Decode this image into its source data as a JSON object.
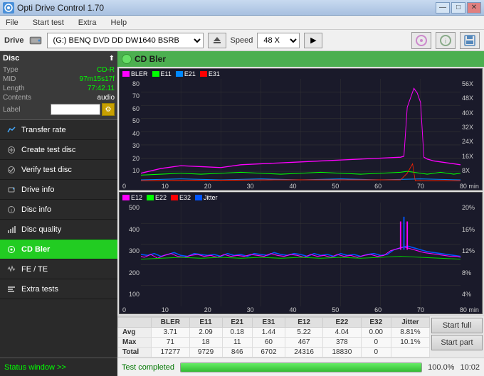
{
  "titlebar": {
    "title": "Opti Drive Control 1.70",
    "icon": "ODC",
    "minimize": "—",
    "maximize": "□",
    "close": "✕"
  },
  "menubar": {
    "items": [
      "File",
      "Start test",
      "Extra",
      "Help"
    ]
  },
  "drivebar": {
    "drive_label": "Drive",
    "drive_value": "(G:)  BENQ DVD DD DW1640 BSRB",
    "speed_label": "Speed",
    "speed_value": "48 X"
  },
  "disc": {
    "title": "Disc",
    "type_label": "Type",
    "type_value": "CD-R",
    "mid_label": "MID",
    "mid_value": "97m15s17f",
    "length_label": "Length",
    "length_value": "77:42.11",
    "contents_label": "Contents",
    "contents_value": "audio",
    "label_label": "Label"
  },
  "nav": {
    "items": [
      {
        "id": "transfer-rate",
        "label": "Transfer rate",
        "active": false
      },
      {
        "id": "create-test-disc",
        "label": "Create test disc",
        "active": false
      },
      {
        "id": "verify-test-disc",
        "label": "Verify test disc",
        "active": false
      },
      {
        "id": "drive-info",
        "label": "Drive info",
        "active": false
      },
      {
        "id": "disc-info",
        "label": "Disc info",
        "active": false
      },
      {
        "id": "disc-quality",
        "label": "Disc quality",
        "active": false
      },
      {
        "id": "cd-bler",
        "label": "CD Bler",
        "active": true
      },
      {
        "id": "fe-te",
        "label": "FE / TE",
        "active": false
      },
      {
        "id": "extra-tests",
        "label": "Extra tests",
        "active": false
      }
    ]
  },
  "status_window": "Status window >>",
  "chart_title": "CD Bler",
  "chart1": {
    "legend": [
      {
        "label": "BLER",
        "color": "#ff00ff"
      },
      {
        "label": "E11",
        "color": "#00ff00"
      },
      {
        "label": "E21",
        "color": "#0000ff"
      },
      {
        "label": "E31",
        "color": "#ff0000"
      }
    ],
    "y_left": [
      "80-",
      "70-",
      "60-",
      "50-",
      "40-",
      "30-",
      "20-",
      "10-"
    ],
    "y_right": [
      "56X",
      "48X",
      "40X",
      "32X",
      "24X",
      "16X",
      "8X"
    ],
    "x_labels": [
      "0",
      "10",
      "20",
      "30",
      "40",
      "50",
      "60",
      "70",
      "80 min"
    ]
  },
  "chart2": {
    "legend": [
      {
        "label": "E12",
        "color": "#ff00ff"
      },
      {
        "label": "E22",
        "color": "#00ff00"
      },
      {
        "label": "E32",
        "color": "#ff0000"
      },
      {
        "label": "Jitter",
        "color": "#0000ff"
      }
    ],
    "y_left": [
      "500-",
      "400-",
      "300-",
      "200-",
      "100-"
    ],
    "y_right": [
      "20%",
      "16%",
      "12%",
      "8%",
      "4%"
    ],
    "x_labels": [
      "0",
      "10",
      "20",
      "30",
      "40",
      "50",
      "60",
      "70",
      "80 min"
    ]
  },
  "table": {
    "headers": [
      "",
      "BLER",
      "E11",
      "E21",
      "E31",
      "E12",
      "E22",
      "E32",
      "Jitter"
    ],
    "rows": [
      {
        "label": "Avg",
        "values": [
          "3.71",
          "2.09",
          "0.18",
          "1.44",
          "5.22",
          "4.04",
          "0.00",
          "8.81%"
        ]
      },
      {
        "label": "Max",
        "values": [
          "71",
          "18",
          "11",
          "60",
          "467",
          "378",
          "0",
          "10.1%"
        ]
      },
      {
        "label": "Total",
        "values": [
          "17277",
          "9729",
          "846",
          "6702",
          "24316",
          "18830",
          "0",
          ""
        ]
      }
    ]
  },
  "buttons": {
    "start_full": "Start full",
    "start_part": "Start part"
  },
  "bottom": {
    "status": "Test completed",
    "progress": 100.0,
    "progress_label": "100.0%",
    "time": "10:02"
  }
}
